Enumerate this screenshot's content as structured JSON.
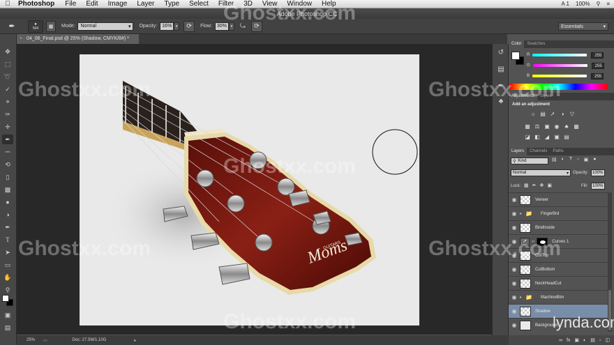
{
  "menubar": {
    "app_name": "Photoshop",
    "items": [
      "File",
      "Edit",
      "Image",
      "Layer",
      "Type",
      "Select",
      "Filter",
      "3D",
      "View",
      "Window",
      "Help"
    ],
    "status": [
      "A 1",
      "100%"
    ]
  },
  "titlebar": {
    "title": "Adobe Photoshop CC"
  },
  "options": {
    "brush_size": "504",
    "mode_label": "Mode:",
    "mode_value": "Normal",
    "opacity_label": "Opacity:",
    "opacity_value": "16%",
    "flow_label": "Flow:",
    "flow_value": "30%",
    "workspace": "Essentials"
  },
  "document": {
    "tab_title": "04_06_Final.psd @ 25% (Shadow, CMYK/8#) *",
    "close_glyph": "×",
    "headstock_brand": "Moms",
    "headstock_sub": "GUITARS"
  },
  "statusbar": {
    "zoom": "25%",
    "doc_info": "Doc: 27.5M/1.10G"
  },
  "color_panel": {
    "tabs": [
      "Color",
      "Swatches"
    ],
    "sliders": [
      {
        "label": "R",
        "value": "255",
        "color": "#00e5ff"
      },
      {
        "label": "G",
        "value": "255",
        "color": "#ff00ff"
      },
      {
        "label": "B",
        "value": "255",
        "color": "#ffff00"
      }
    ]
  },
  "adjustments_panel": {
    "tabs": [
      "Adjustments",
      "Styles"
    ],
    "heading": "Add an adjustment"
  },
  "layers_panel": {
    "tabs": [
      "Layers",
      "Channels",
      "Paths"
    ],
    "kind": "Kind",
    "blend_mode": "Normal",
    "opacity_label": "Opacity:",
    "opacity_value": "100%",
    "lock_label": "Lock:",
    "fill_label": "Fill:",
    "fill_value": "100%",
    "layers": [
      {
        "name": "Veneer",
        "kind": "layer",
        "selected": false
      },
      {
        "name": "FingerBrd",
        "kind": "group",
        "selected": false
      },
      {
        "name": "BindInside",
        "kind": "layer",
        "selected": false
      },
      {
        "name": "Curves 1",
        "kind": "adjustment",
        "selected": false
      },
      {
        "name": "CutTop",
        "kind": "layer",
        "selected": false
      },
      {
        "name": "CutBottom",
        "kind": "layer",
        "selected": false
      },
      {
        "name": "NeckHeadCut",
        "kind": "layer",
        "selected": false
      },
      {
        "name": "MachineBtm",
        "kind": "group",
        "selected": false
      },
      {
        "name": "Shadow",
        "kind": "layer",
        "selected": true
      },
      {
        "name": "Background",
        "kind": "layer",
        "selected": false
      }
    ]
  },
  "watermarks": {
    "site": "Ghostxx.com",
    "brand": "lynda.com"
  }
}
